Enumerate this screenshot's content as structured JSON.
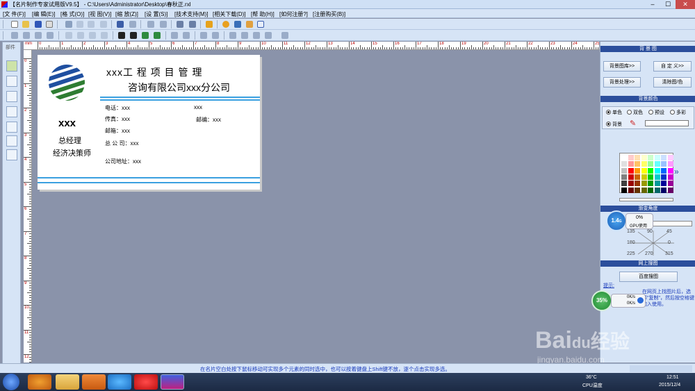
{
  "window": {
    "title": "【名片制作专家试用版V9.5】 - C:\\Users\\Administrator\\Desktop\\春秋正.rxl",
    "minimize": "–",
    "maximize": "☐",
    "close": "✕"
  },
  "menu": [
    "[文 件(F)]",
    "[编 辑(E)]",
    "[格 式(O)]",
    "[视 图(V)]",
    "[缩 放(Z)]",
    "[设 置(S)]",
    "[技术支持(M)]",
    "[相关下载(D)]",
    "[帮 助(H)]",
    "[如何注册?]",
    "[注册购买(B)]"
  ],
  "palette": {
    "label": "部件"
  },
  "ruler": {
    "unit": "mm",
    "top_numbers": [
      "0",
      "1",
      "2",
      "3",
      "4",
      "5",
      "6",
      "7",
      "8",
      "9",
      "10",
      "11",
      "12",
      "13",
      "14",
      "15",
      "16",
      "17",
      "18",
      "19",
      "20",
      "21",
      "22",
      "23",
      "24",
      "25",
      "26"
    ],
    "left_numbers": [
      "0",
      "1",
      "2",
      "3",
      "4",
      "5",
      "6",
      "7",
      "8",
      "9",
      "10",
      "11",
      "12"
    ]
  },
  "card": {
    "company_line1": "xxx工 程 项 目 管 理",
    "company_line2": "咨询有限公司xxx分公司",
    "name": "xxx",
    "title1": "总经理",
    "title2": "经济决策师",
    "phone": "电话：xxx",
    "phone2": "xxx",
    "fax": "传真：xxx",
    "postcode": "邮编：xxx",
    "email": "邮箱：xxx",
    "hq": "总  公  司：xxx",
    "address": "公司地址：xxx",
    "colors": {
      "line": "#3aa0e0",
      "logo_blue": "#1f4fa0",
      "logo_green": "#2e7d32"
    }
  },
  "right_panel": {
    "bg_image_header": "背 景 图",
    "btn_bg_library": "背景图库>>",
    "btn_custom": "自 定 义>>",
    "btn_bg_process": "背景处理>>",
    "btn_clear": "清除图/色",
    "bg_color_header": "背景颜色",
    "radio_single": "单色",
    "radio_double": "双色",
    "radio_preset": "预设",
    "radio_multi": "多彩",
    "radio_bg": "背景",
    "gradient_header": "渐变角度",
    "angles": [
      "135",
      "90",
      "45",
      "180",
      "0",
      "225",
      "270",
      "315"
    ],
    "web_header": "网上搜图",
    "btn_baidu": "百度搜图",
    "hint_label": "提示:",
    "hint_text": "在网页上找图片后，选择\"复制\"，然后按空格键加入使用。"
  },
  "overlays": {
    "gpu_value": "1.4",
    "gpu_unit": "G",
    "gpu_percent": "0%",
    "gpu_label": "GPU使用",
    "net_percent": "35%",
    "net_up": "0K/s",
    "net_down": "0K/s"
  },
  "status": {
    "message": "在名片空白处按下鼠标移动可实现多个元素的同时选中，也可以按着键盘上Shift键不放，逐个点击实现多选。"
  },
  "taskbar": {
    "temp": "36°C",
    "temp_label": "CPU温度",
    "time": "12:51",
    "date": "2015/12/4"
  },
  "watermark": {
    "line1": "Bai",
    "line2": "du",
    "line3": "经验",
    "url": "jingyan.baidu.com"
  }
}
